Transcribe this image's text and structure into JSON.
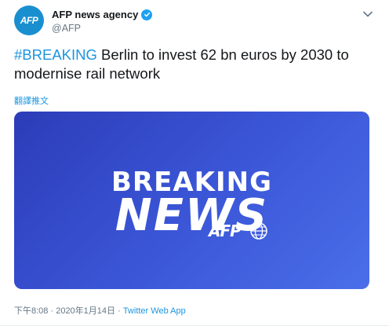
{
  "account": {
    "avatar_text": "AFP",
    "display_name": "AFP news agency",
    "handle": "@AFP"
  },
  "tweet": {
    "hashtag": "#BREAKING",
    "text": " Berlin to invest 62 bn euros by 2030 to modernise rail network",
    "translate_label": "翻譯推文"
  },
  "media": {
    "line1": "BREAKING",
    "line2": "NEWS",
    "logo": "AFP",
    "background_start": "#2c3cb8",
    "background_end": "#4a6eea"
  },
  "meta": {
    "time": "下午8:08",
    "date": "2020年1月14日",
    "separator": " · ",
    "client": "Twitter Web App"
  },
  "icons": {
    "verified": "verified-badge-icon",
    "chevron": "chevron-down-icon"
  },
  "colors": {
    "link": "#1b95e0",
    "verified": "#1da1f2",
    "secondary_text": "#657786"
  }
}
